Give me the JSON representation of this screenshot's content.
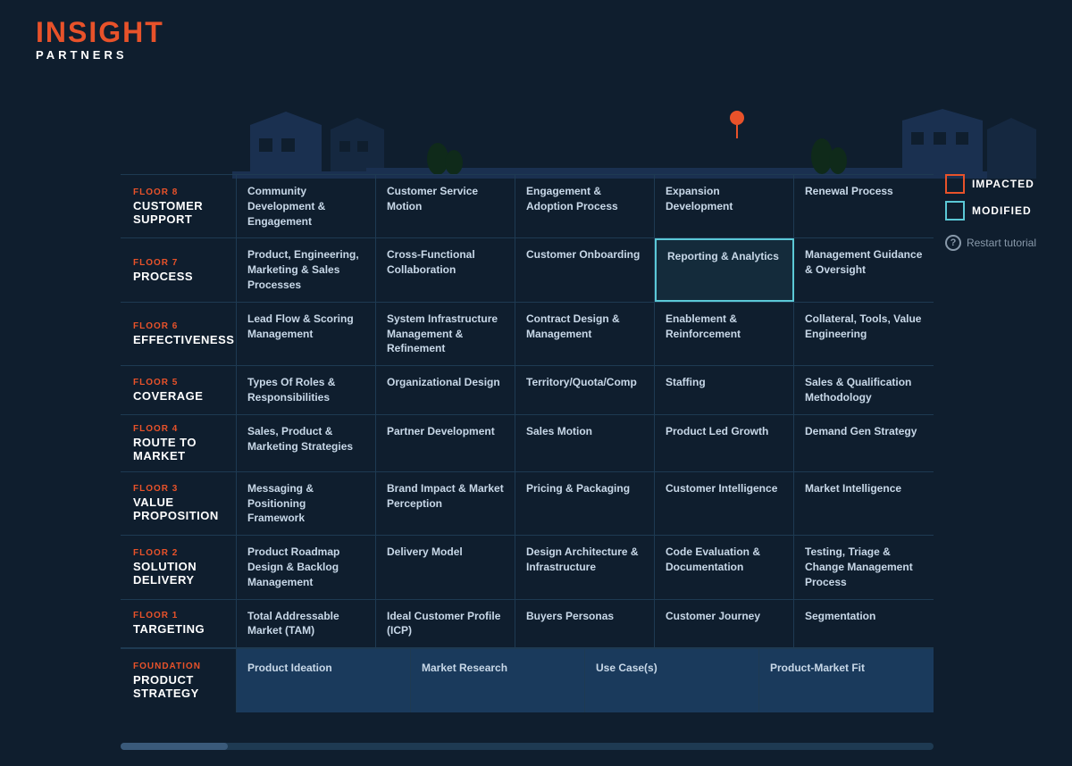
{
  "logo": {
    "insight": "INSIGHT",
    "partners": "PARTNERS"
  },
  "legend": {
    "impacted_label": "IMPACTED",
    "modified_label": "MODIFIED",
    "restart_label": "Restart tutorial"
  },
  "floors": [
    {
      "number": "FLOOR 8",
      "name": "CUSTOMER SUPPORT",
      "cells": [
        "Community Development & Engagement",
        "Customer Service Motion",
        "Engagement & Adoption Process",
        "Expansion Development",
        "Renewal Process"
      ]
    },
    {
      "number": "FLOOR 7",
      "name": "PROCESS",
      "cells": [
        "Product, Engineering, Marketing & Sales Processes",
        "Cross-Functional Collaboration",
        "Customer Onboarding",
        "Reporting & Analytics",
        "Management Guidance & Oversight"
      ]
    },
    {
      "number": "FLOOR 6",
      "name": "EFFECTIVENESS",
      "cells": [
        "Lead Flow & Scoring Management",
        "System Infrastructure Management & Refinement",
        "Contract Design & Management",
        "Enablement & Reinforcement",
        "Collateral, Tools, Value Engineering"
      ]
    },
    {
      "number": "FLOOR 5",
      "name": "COVERAGE",
      "cells": [
        "Types Of Roles & Responsibilities",
        "Organizational Design",
        "Territory/Quota/Comp",
        "Staffing",
        "Sales & Qualification Methodology"
      ]
    },
    {
      "number": "FLOOR 4",
      "name": "ROUTE TO MARKET",
      "cells": [
        "Sales, Product & Marketing Strategies",
        "Partner Development",
        "Sales Motion",
        "Product Led Growth",
        "Demand Gen Strategy"
      ]
    },
    {
      "number": "FLOOR 3",
      "name": "VALUE PROPOSITION",
      "cells": [
        "Messaging & Positioning Framework",
        "Brand Impact & Market Perception",
        "Pricing & Packaging",
        "Customer Intelligence",
        "Market Intelligence"
      ]
    },
    {
      "number": "FLOOR 2",
      "name": "SOLUTION DELIVERY",
      "cells": [
        "Product Roadmap Design & Backlog Management",
        "Delivery Model",
        "Design Architecture & Infrastructure",
        "Code Evaluation & Documentation",
        "Testing, Triage & Change Management Process"
      ]
    },
    {
      "number": "FLOOR 1",
      "name": "TARGETING",
      "cells": [
        "Total Addressable Market (TAM)",
        "Ideal Customer Profile (ICP)",
        "Buyers Personas",
        "Customer Journey",
        "Segmentation"
      ]
    }
  ],
  "foundation": {
    "number": "FOUNDATION",
    "name": "PRODUCT STRATEGY",
    "cells": [
      "Product Ideation",
      "Market Research",
      "Use Case(s)",
      "Product-Market Fit"
    ]
  }
}
